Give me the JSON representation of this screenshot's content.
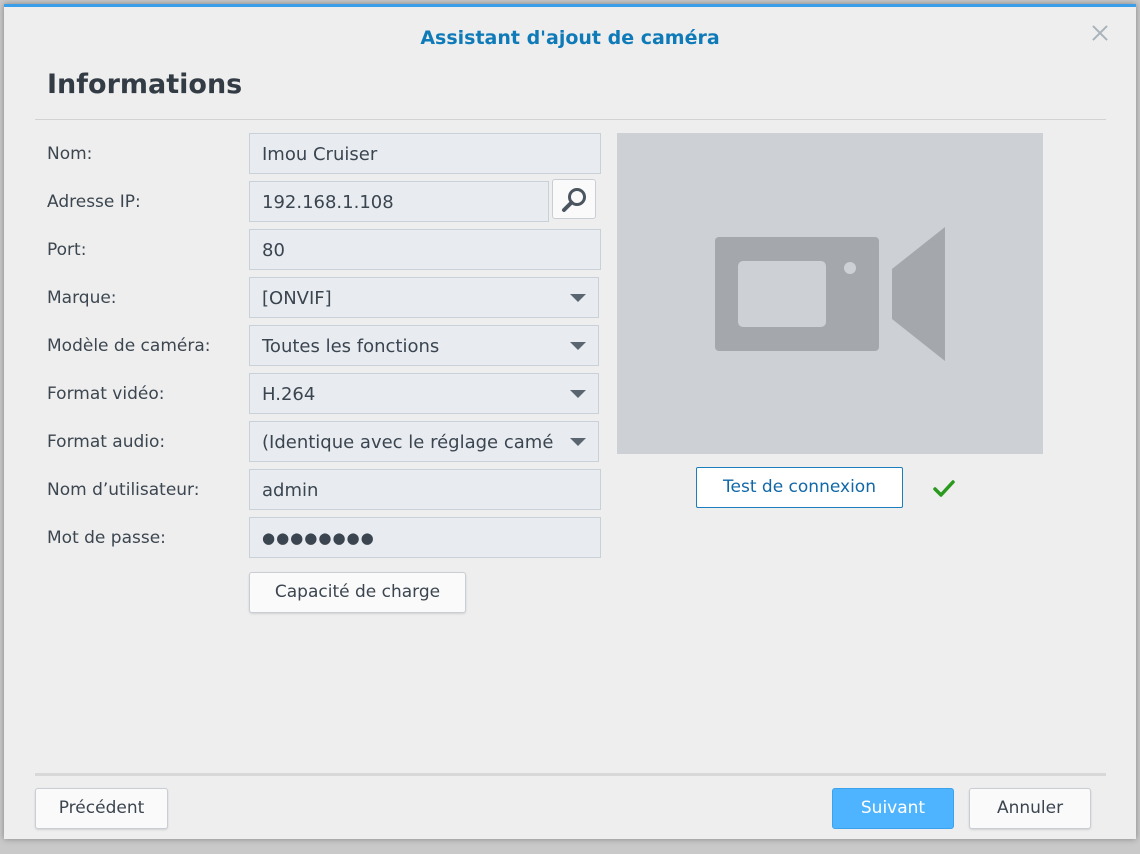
{
  "dialog": {
    "title": "Assistant d'ajout de caméra",
    "section_title": "Informations"
  },
  "form": {
    "name_label": "Nom:",
    "name_value": "Imou Cruiser",
    "ip_label": "Adresse IP:",
    "ip_value": "192.168.1.108",
    "port_label": "Port:",
    "port_value": "80",
    "brand_label": "Marque:",
    "brand_value": "[ONVIF]",
    "model_label": "Modèle de caméra:",
    "model_value": "Toutes les fonctions",
    "video_label": "Format vidéo:",
    "video_value": "H.264",
    "audio_label": "Format audio:",
    "audio_value": "(Identique avec le réglage camé",
    "user_label": "Nom d’utilisateur:",
    "user_value": "admin",
    "password_label": "Mot de passe:",
    "password_value": "●●●●●●●●",
    "capacity_button": "Capacité de charge"
  },
  "preview": {
    "icon": "video-camera-icon",
    "test_button": "Test de connexion",
    "status_icon": "checkmark-icon",
    "status_color": "#2a9a1f"
  },
  "footer": {
    "previous": "Précédent",
    "next": "Suivant",
    "cancel": "Annuler"
  },
  "colors": {
    "accent": "#3a9ee8",
    "title": "#0f7ab8",
    "primary_button": "#4fb4ff"
  }
}
